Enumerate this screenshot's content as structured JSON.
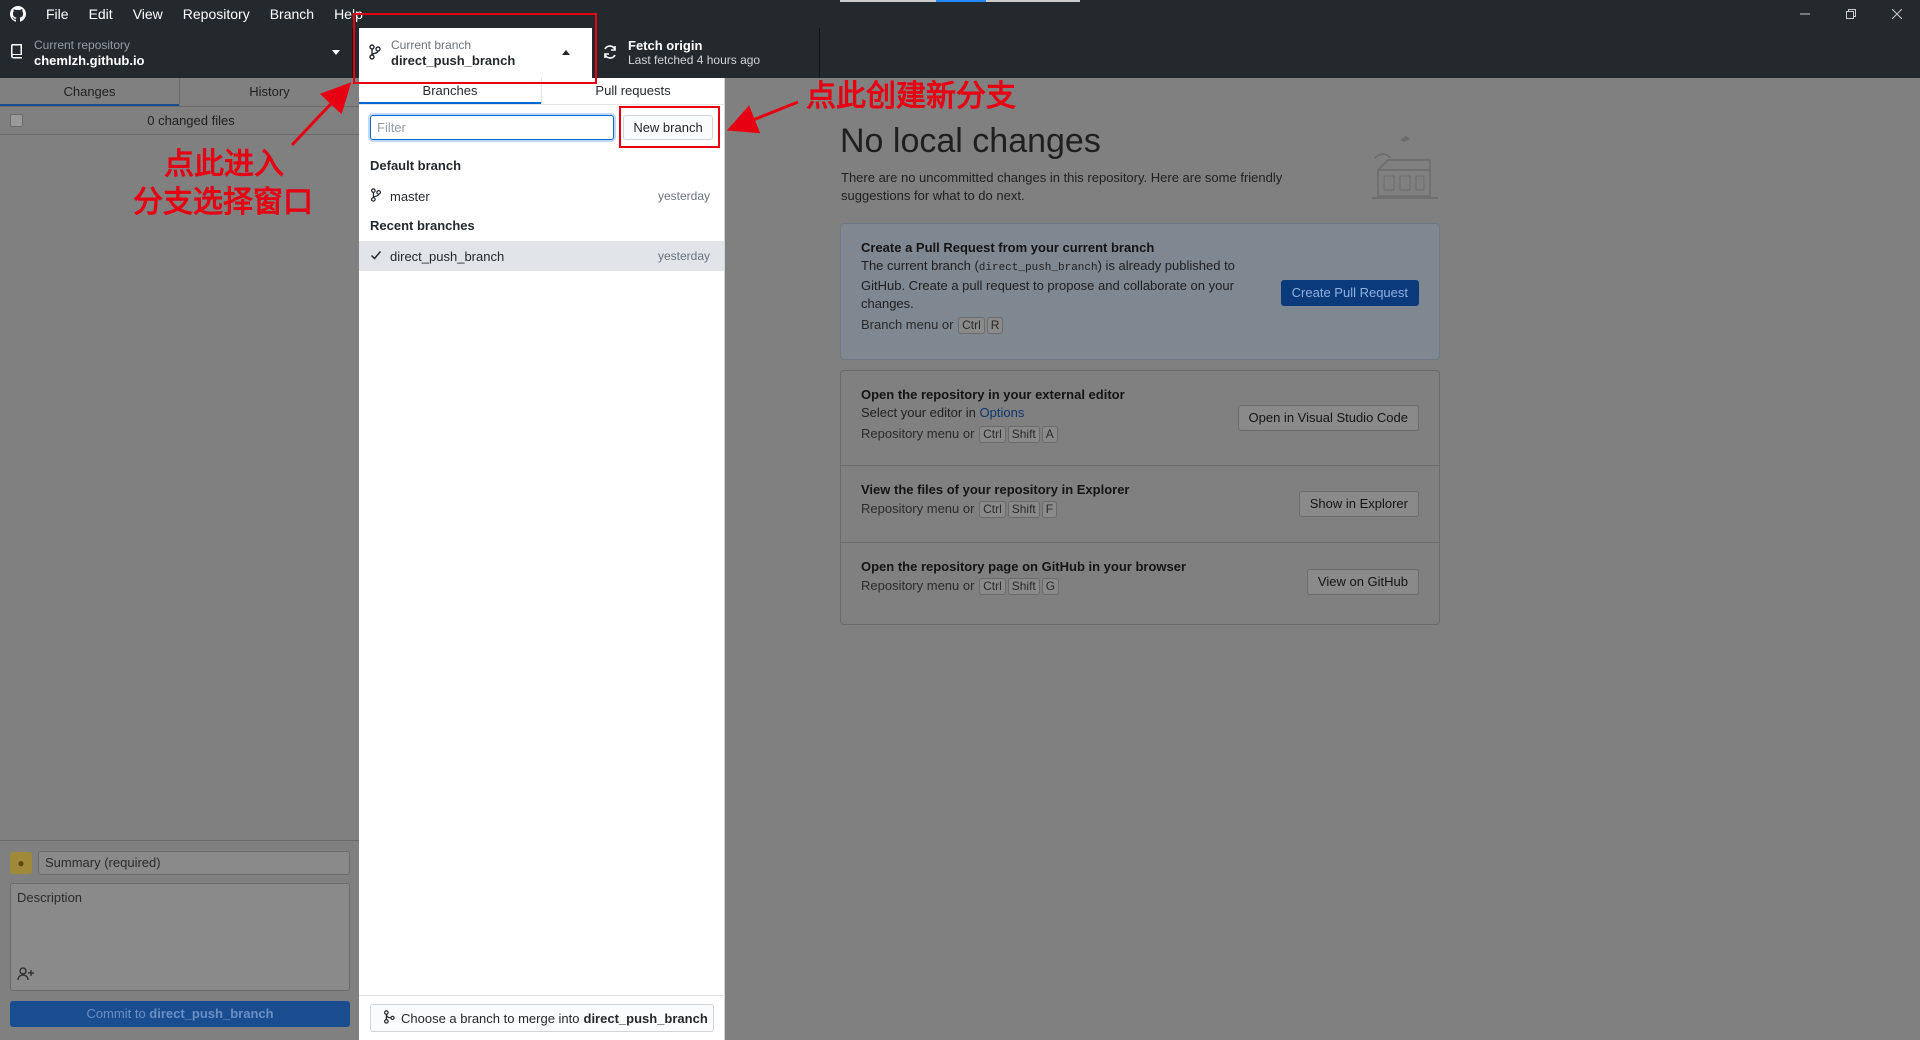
{
  "menu": [
    "File",
    "Edit",
    "View",
    "Repository",
    "Branch",
    "Help"
  ],
  "toolbar": {
    "repo_label": "Current repository",
    "repo_name": "chemlzh.github.io",
    "branch_label": "Current branch",
    "branch_name": "direct_push_branch",
    "fetch_title": "Fetch origin",
    "fetch_sub": "Last fetched 4 hours ago"
  },
  "sidebar": {
    "tabs": [
      "Changes",
      "History"
    ],
    "changed_files": "0 changed files",
    "summary_placeholder": "Summary (required)",
    "description_placeholder": "Description",
    "commit_prefix": "Commit to",
    "commit_branch": "direct_push_branch"
  },
  "branch_popup": {
    "tabs": [
      "Branches",
      "Pull requests"
    ],
    "filter_placeholder": "Filter",
    "new_branch": "New branch",
    "default_heading": "Default branch",
    "default_branch": {
      "name": "master",
      "date": "yesterday"
    },
    "recent_heading": "Recent branches",
    "recent_branch": {
      "name": "direct_push_branch",
      "date": "yesterday"
    },
    "merge_label": "Choose a branch to merge into",
    "merge_branch": "direct_push_branch"
  },
  "main": {
    "title": "No local changes",
    "description": "There are no uncommitted changes in this repository. Here are some friendly suggestions for what to do next.",
    "pr_card": {
      "title": "Create a Pull Request from your current branch",
      "text_before": "The current branch (",
      "text_code": "direct_push_branch",
      "text_after": ") is already published to GitHub. Create a pull request to propose and collaborate on your changes.",
      "hint": "Branch menu or",
      "keys": [
        "Ctrl",
        "R"
      ],
      "button": "Create Pull Request"
    },
    "editor_card": {
      "title": "Open the repository in your external editor",
      "text": "Select your editor in",
      "link": "Options",
      "hint": "Repository menu or",
      "keys": [
        "Ctrl",
        "Shift",
        "A"
      ],
      "button": "Open in Visual Studio Code"
    },
    "explorer_card": {
      "title": "View the files of your repository in Explorer",
      "hint": "Repository menu or",
      "keys": [
        "Ctrl",
        "Shift",
        "F"
      ],
      "button": "Show in Explorer"
    },
    "github_card": {
      "title": "Open the repository page on GitHub in your browser",
      "hint": "Repository menu or",
      "keys": [
        "Ctrl",
        "Shift",
        "G"
      ],
      "button": "View on GitHub"
    }
  },
  "annotations": {
    "enter_line1": "点此进入",
    "enter_line2": "分支选择窗口",
    "create": "点此创建新分支",
    "color": "#e60012"
  }
}
